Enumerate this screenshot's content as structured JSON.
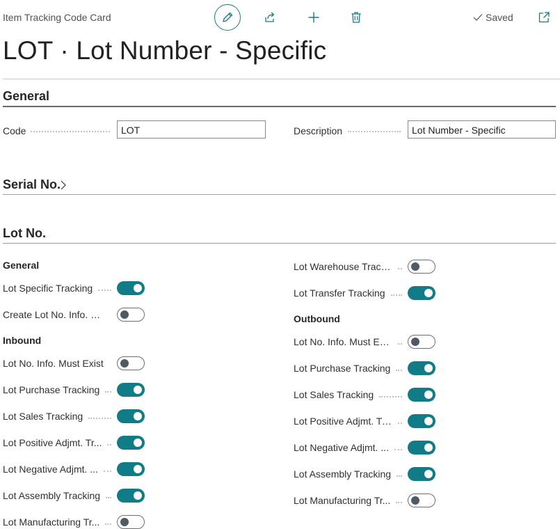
{
  "header": {
    "breadcrumb": "Item Tracking Code Card",
    "saved_label": "Saved",
    "title": "LOT · Lot Number - Specific",
    "icons": [
      "edit-icon",
      "share-icon",
      "add-icon",
      "delete-icon",
      "checkmark-icon",
      "popout-icon"
    ]
  },
  "general": {
    "heading": "General",
    "code_label": "Code",
    "code_value": "LOT",
    "description_label": "Description",
    "description_value": "Lot Number - Specific"
  },
  "serial": {
    "heading": "Serial No."
  },
  "lot": {
    "heading": "Lot No.",
    "left": {
      "general_heading": "General",
      "general_rows": [
        {
          "label": "Lot Specific Tracking",
          "on": true
        },
        {
          "label": "Create Lot No. Info. o...",
          "on": false
        }
      ],
      "inbound_heading": "Inbound",
      "inbound_rows": [
        {
          "label": "Lot No. Info. Must Exist",
          "on": false
        },
        {
          "label": "Lot Purchase Tracking",
          "on": true
        },
        {
          "label": "Lot Sales Tracking",
          "on": true
        },
        {
          "label": "Lot Positive Adjmt. Tr...",
          "on": true
        },
        {
          "label": "Lot Negative Adjmt. ...",
          "on": true
        },
        {
          "label": "Lot Assembly Tracking",
          "on": true
        },
        {
          "label": "Lot Manufacturing Tr...",
          "on": false
        }
      ]
    },
    "right": {
      "top_rows": [
        {
          "label": "Lot Warehouse Tracki...",
          "on": false
        },
        {
          "label": "Lot Transfer Tracking",
          "on": true
        }
      ],
      "outbound_heading": "Outbound",
      "outbound_rows": [
        {
          "label": "Lot No. Info. Must Exist",
          "on": false
        },
        {
          "label": "Lot Purchase Tracking",
          "on": true
        },
        {
          "label": "Lot Sales Tracking",
          "on": true
        },
        {
          "label": "Lot Positive Adjmt. Tr...",
          "on": true
        },
        {
          "label": "Lot Negative Adjmt. ...",
          "on": true
        },
        {
          "label": "Lot Assembly Tracking",
          "on": true
        },
        {
          "label": "Lot Manufacturing Tr...",
          "on": false
        }
      ]
    }
  },
  "colors": {
    "accent": "#117c87",
    "toggle_off_knob": "#505a64"
  }
}
